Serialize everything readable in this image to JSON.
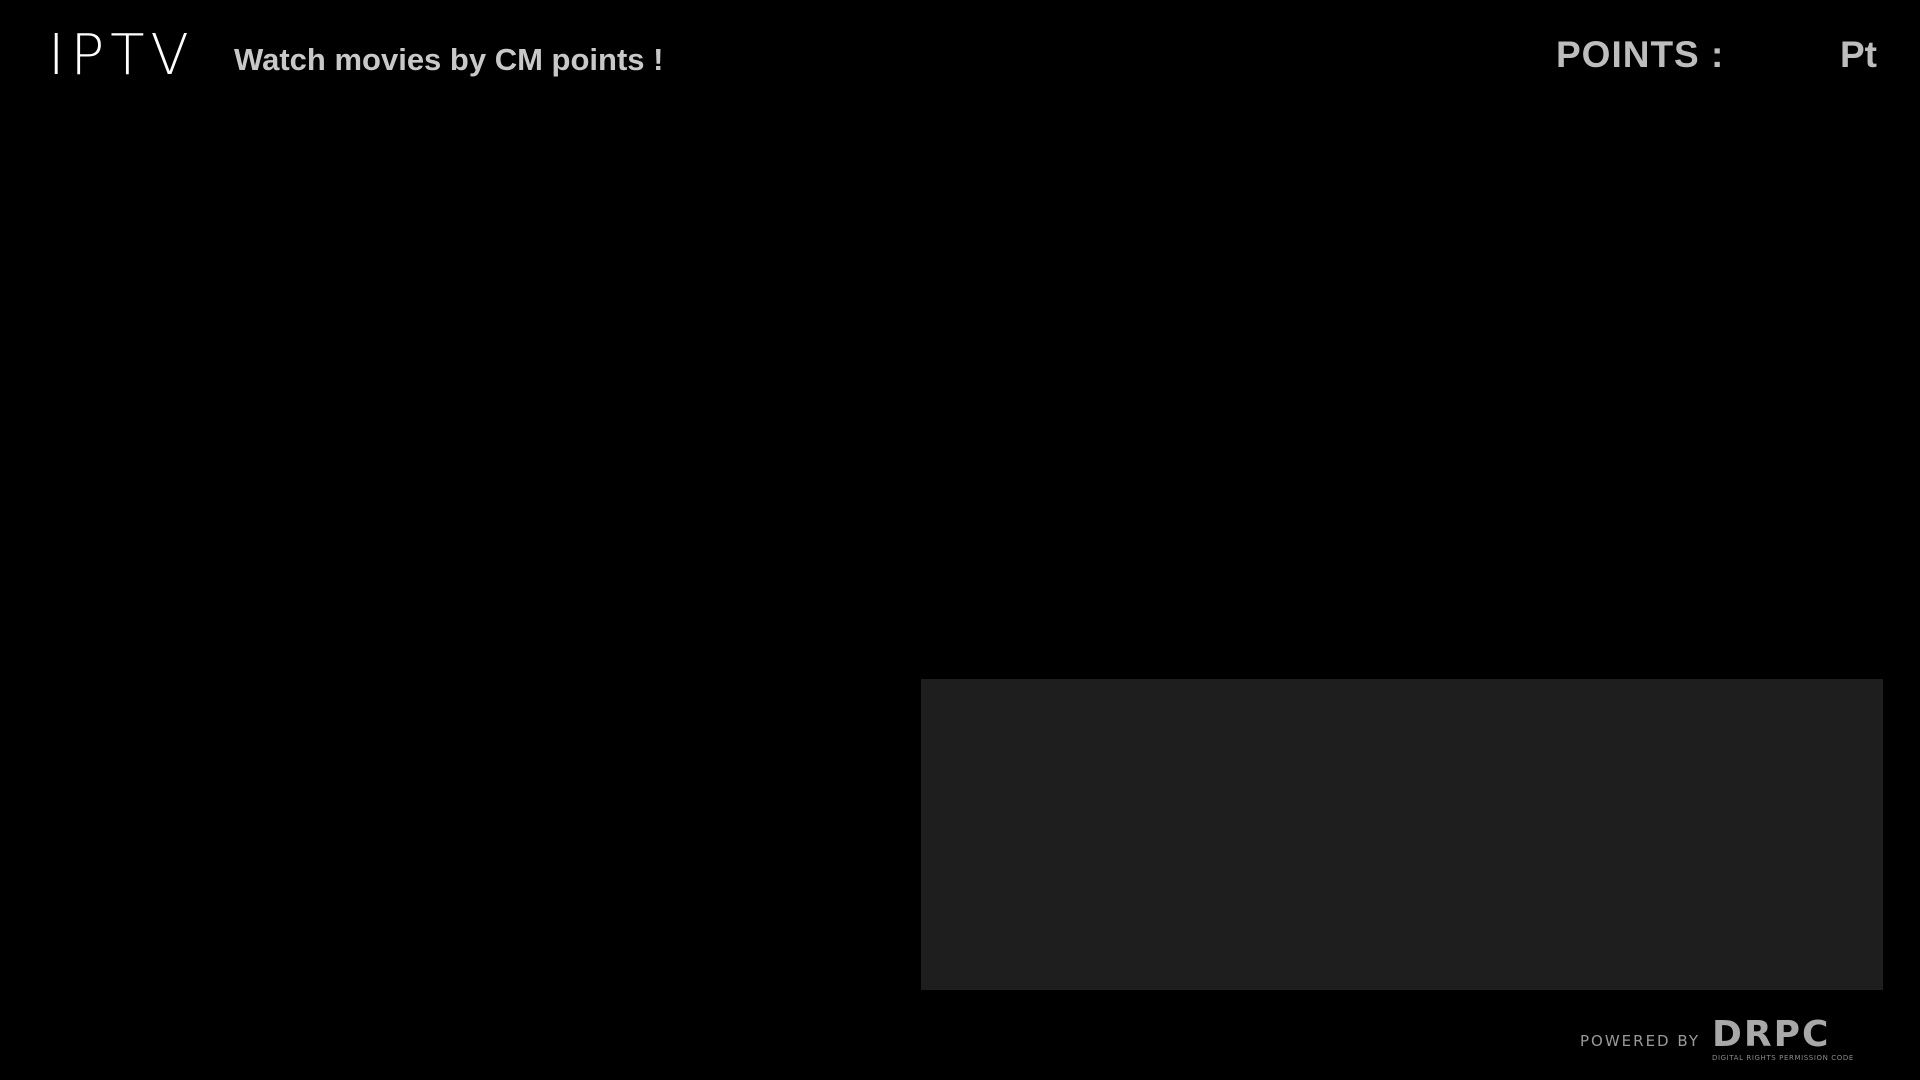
{
  "header": {
    "logo_text": "IPTV",
    "tagline": "Watch movies by CM points !",
    "points_label": "POINTS :",
    "points_value": "",
    "points_unit": "Pt"
  },
  "footer": {
    "powered_by": "POWERED BY",
    "brand": "DRPC",
    "brand_subtitle": "DIGITAL RIGHTS PERMISSION CODE"
  },
  "colors": {
    "background": "#000000",
    "panel": "#1e1e1e",
    "text_primary": "#ffffff",
    "text_secondary": "#bdbdbd"
  }
}
